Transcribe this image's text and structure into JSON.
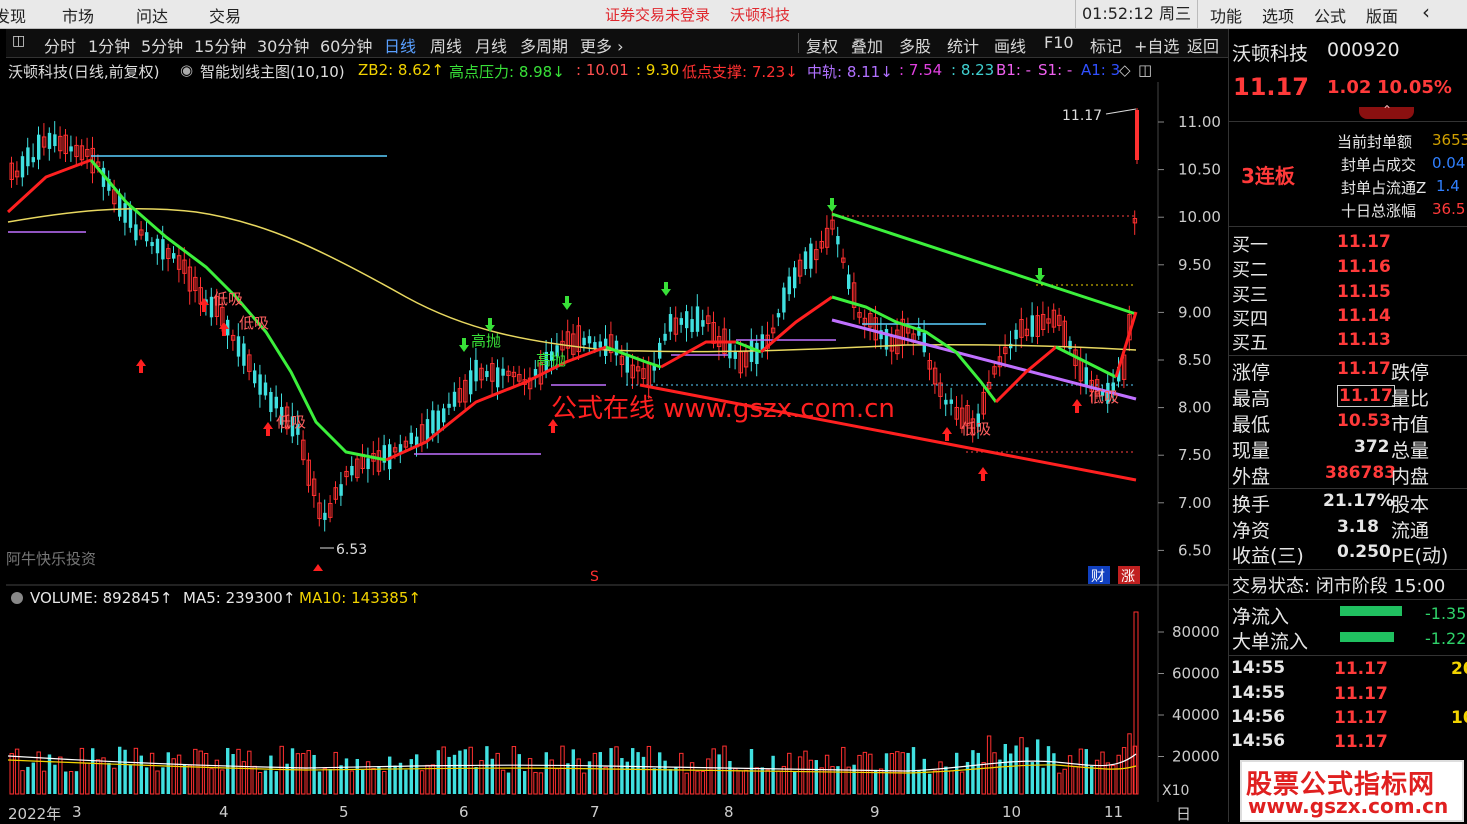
{
  "topbar": {
    "menus": [
      "发现",
      "市场",
      "问达",
      "交易"
    ],
    "login_warning": "证券交易未登录",
    "stock_title": "沃顿科技",
    "clock": "01:52:12 周三",
    "right_menus": [
      "功能",
      "选项",
      "公式",
      "版面"
    ],
    "back_arrow": "‹"
  },
  "toolbar": {
    "periods": [
      "分时",
      "1分钟",
      "5分钟",
      "15分钟",
      "30分钟",
      "60分钟",
      "日线",
      "周线",
      "月线",
      "多周期",
      "更多 ›"
    ],
    "active": "日线",
    "tools": [
      "复权",
      "叠加",
      "多股",
      "统计",
      "画线",
      "F10",
      "标记",
      "+自选",
      "返回"
    ]
  },
  "indicator_bar": {
    "name": "沃顿科技(日线,前复权)",
    "formula": "智能划线主图(10,10)",
    "zb2": "ZB2: 8.62↑",
    "high_press": "高点压力: 8.98↓",
    "v1": ": 10.01",
    "v2": ": 9.30",
    "low_support": "低点支撑: 7.23↓",
    "mid_track": "中轨: 8.11↓",
    "v3": ": 7.54",
    "v4": ": 8.23",
    "b1": "B1: -",
    "s1": "S1: -",
    "a1": "A1: 3"
  },
  "main_chart": {
    "price_axis": [
      "11.00",
      "10.50",
      "10.00",
      "9.50",
      "9.00",
      "8.50",
      "8.00",
      "7.50",
      "7.00",
      "6.50"
    ],
    "high_label": "11.17",
    "low_label": "6.53",
    "annotations": [
      "低吸",
      "低吸",
      "低吸",
      "高抛",
      "高抛",
      "低吸",
      "低吸"
    ],
    "watermark_text": "公式在线 www.gszx.com.cn",
    "author_text": "阿牛快乐投资",
    "badge_cai": "财",
    "badge_zhang": "涨",
    "badge_s": "S"
  },
  "vol_chart": {
    "volume": "VOLUME: 892845↑",
    "ma5": "MA5: 239300↑",
    "ma10": "MA10: 143385↑",
    "axis": [
      "80000",
      "60000",
      "40000",
      "20000"
    ],
    "unit": "X10"
  },
  "x_axis": {
    "labels": [
      "2022年",
      "3",
      "4",
      "5",
      "6",
      "7",
      "8",
      "9",
      "10",
      "11"
    ],
    "right_label": "日"
  },
  "panel": {
    "name": "沃顿科技",
    "code": "000920",
    "price": "11.17",
    "change": "1.02",
    "pct": "10.05%",
    "limit_badge": "3连板",
    "seal_rows": [
      {
        "label": "当前封单额",
        "value": "3653"
      },
      {
        "label": "封单占成交",
        "value": "0.04"
      },
      {
        "label": "封单占流通Z",
        "value": "1.4"
      },
      {
        "label": "十日总涨幅",
        "value": "36.5"
      }
    ],
    "bids": [
      {
        "label": "买一",
        "value": "11.17"
      },
      {
        "label": "买二",
        "value": "11.16"
      },
      {
        "label": "买三",
        "value": "11.15"
      },
      {
        "label": "买四",
        "value": "11.14"
      },
      {
        "label": "买五",
        "value": "11.13"
      }
    ],
    "stats": [
      {
        "l1": "涨停",
        "v1": "11.17",
        "l2": "跌停"
      },
      {
        "l1": "最高",
        "v1": "11.17",
        "l2": "量比"
      },
      {
        "l1": "最低",
        "v1": "10.53",
        "l2": "市值"
      },
      {
        "l1": "现量",
        "v1": "372",
        "l2": "总量"
      },
      {
        "l1": "外盘",
        "v1": "386783",
        "l2": "内盘"
      },
      {
        "l1": "换手",
        "v1": "21.17%",
        "l2": "股本"
      },
      {
        "l1": "净资",
        "v1": "3.18",
        "l2": "流通"
      },
      {
        "l1": "收益(三)",
        "v1": "0.250",
        "l2": "PE(动)"
      }
    ],
    "trade_status": "交易状态: 闭市阶段 15:00",
    "flows": [
      {
        "label": "净流入",
        "value": "-1.35"
      },
      {
        "label": "大单流入",
        "value": "-1.22"
      }
    ],
    "ticks": [
      {
        "time": "14:55",
        "price": "11.17",
        "vol": "20"
      },
      {
        "time": "14:55",
        "price": "11.17",
        "vol": ""
      },
      {
        "time": "14:56",
        "price": "11.17",
        "vol": "10"
      },
      {
        "time": "14:56",
        "price": "11.17",
        "vol": ""
      }
    ]
  },
  "site_watermark": {
    "line1": "股票公式指标网",
    "line2": "www.gszx.com.cn"
  }
}
